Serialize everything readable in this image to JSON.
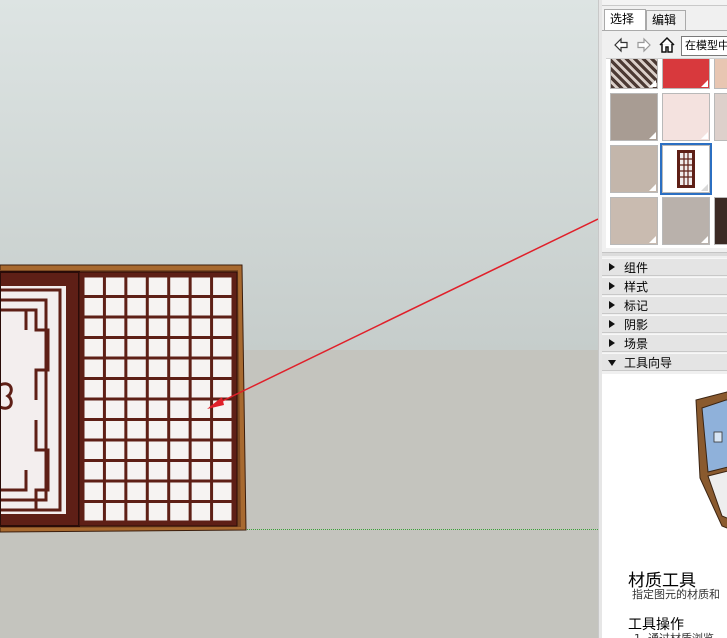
{
  "tray": {
    "tabs": [
      {
        "label": "选择"
      },
      {
        "label": "编辑"
      }
    ],
    "collection_select": "在模型中",
    "nav_icons": [
      "back-arrow-icon",
      "forward-arrow-icon",
      "home-icon"
    ],
    "swatch_colors": [
      "#d8393d",
      "#e8c6b2",
      "#a89c93",
      "#f4e2df",
      "#ddd0cb",
      "#c3b6ab",
      "#c9bbb0",
      "#b9b1ab",
      "#3b2a24",
      "#ffffff"
    ],
    "selected_swatch": "window-lattice-material",
    "panels": [
      {
        "label": "组件",
        "expanded": false
      },
      {
        "label": "样式",
        "expanded": false
      },
      {
        "label": "标记",
        "expanded": false
      },
      {
        "label": "阴影",
        "expanded": false
      },
      {
        "label": "场景",
        "expanded": false
      },
      {
        "label": "工具向导",
        "expanded": true
      }
    ],
    "guide": {
      "title": "材质工具",
      "description": "指定图元的材质和",
      "operations_heading": "工具操作",
      "step_1": "1. 通过材质浏览"
    }
  },
  "colors": {
    "selection_blue": "#2b6fc2",
    "annotation_red": "#e0202a",
    "frame_wood": "#6b2a1c",
    "outer_frame": "#a86a30",
    "green_axis": "#3aa23a"
  }
}
